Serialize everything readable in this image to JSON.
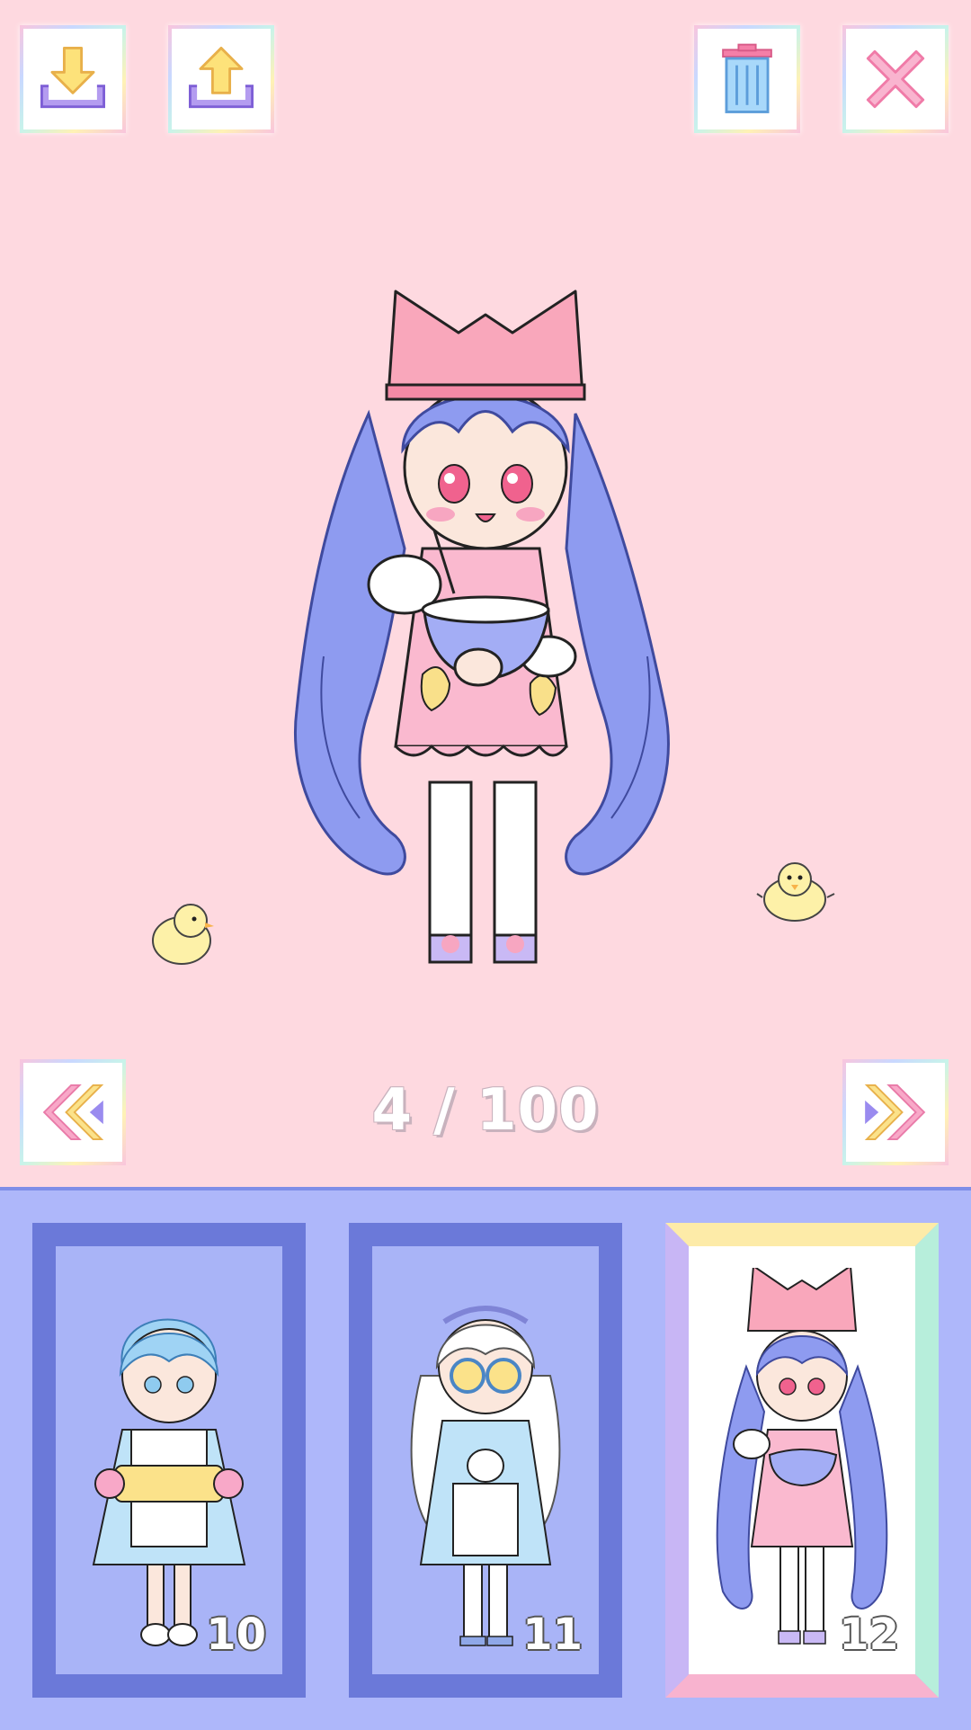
{
  "toolbar": {
    "download_icon": "download-icon",
    "upload_icon": "upload-icon",
    "delete_icon": "trash-icon",
    "close_icon": "close-icon"
  },
  "navigation": {
    "prev_icon": "double-chevron-left-icon",
    "next_icon": "double-chevron-right-icon",
    "page_counter": "4 / 100"
  },
  "slots": [
    {
      "number": "10",
      "selected": false
    },
    {
      "number": "11",
      "selected": false
    },
    {
      "number": "12",
      "selected": true
    }
  ],
  "colors": {
    "background": "#FED9E0",
    "panel": "#AEB7FA",
    "panel_frame": "#6B79D9",
    "hair": "#8E9BF0",
    "hat": "#F9A7BB",
    "apron": "#FAB9CF"
  }
}
